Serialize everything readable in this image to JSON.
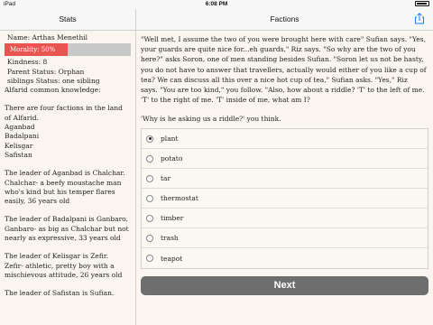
{
  "status_bar": {
    "carrier": "iPad",
    "time": "6:08 PM"
  },
  "left_panel": {
    "title": "Stats",
    "name": "Name: Arthas Menethil",
    "morality": {
      "label": "Morality: 50%",
      "value": 0.5,
      "fill_color": "#e85551",
      "track_color": "#c8c8c8"
    },
    "kindness": "Kindness: 8",
    "parent_status": "Parent Status: Orphan",
    "siblings": "siblings Status: one sibling",
    "knowledge_header": "Alfarid common knowledge:",
    "factions_intro": "There are four factions in the land of Alfarid.",
    "faction_names": [
      "Aganbad",
      "Badalpani",
      "Kelisgar",
      "Safistan"
    ],
    "leaders": [
      "The leader of Aganbad is Chalchar.",
      "Chalchar- a beefy moustache man who's kind but his temper flares easily, 36 years old",
      "The leader of Badalpani is Ganbaro.",
      "Ganbaro- as big as Chalchar but not nearly as expressive, 33 years old",
      "The leader of Kelisgar is Zefir.",
      "Zefir- athletic, pretty boy with a mischievous attitude, 26 years old",
      "The leader of Safistan is Sufian."
    ]
  },
  "right_panel": {
    "title": "Factions",
    "share_icon": "share-icon",
    "story": [
      "\"Well met, I assume the two of you were brought here with care\" Sufian says. \"Yes, your guards are quite nice for...eh guards,\" Riz says. \"So why are the two of you here?\" asks Soron, one of men standing besides Sufian. \"Soron let us not be hasty, you do not have to answer that travellers, actually would either of you like a cup of tea? We can discuss all this over a nice hot cup of tea,\" Sufian asks. \"Yes,\" Riz says. \"You are too kind,\" you follow. \"Also, how about a riddle? 'T' to the left of me. 'T' to the right of me. 'T' inside of me, what am I?",
      "'Why is he asking us a riddle?' you think."
    ],
    "options": [
      {
        "label": "plant",
        "selected": true
      },
      {
        "label": "potato",
        "selected": false
      },
      {
        "label": "tar",
        "selected": false
      },
      {
        "label": "thermostat",
        "selected": false
      },
      {
        "label": "timber",
        "selected": false
      },
      {
        "label": "trash",
        "selected": false
      },
      {
        "label": "teapot",
        "selected": false
      }
    ],
    "next_button": "Next"
  }
}
